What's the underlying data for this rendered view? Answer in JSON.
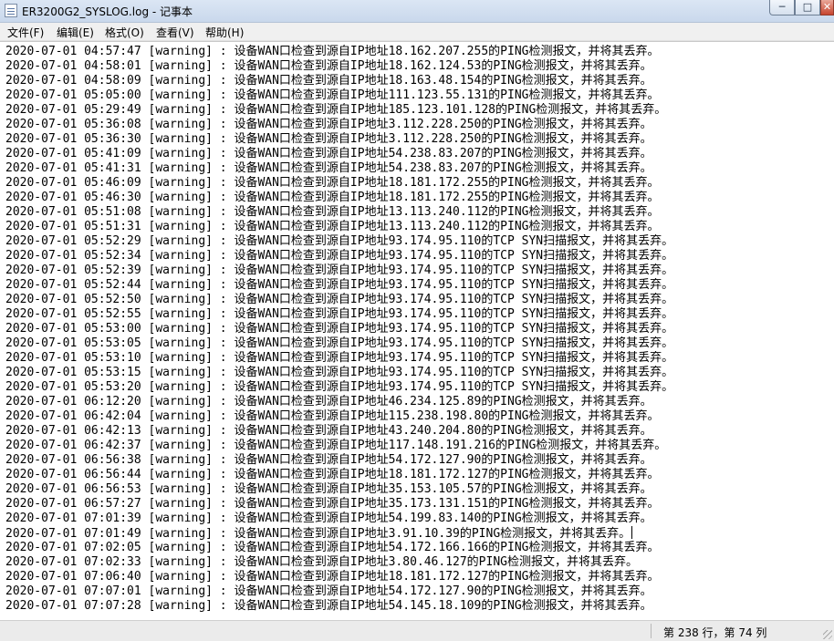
{
  "window": {
    "title": "ER3200G2_SYSLOG.log - 记事本",
    "controls": {
      "minimize": "─",
      "maximize": "□",
      "close": "✕"
    }
  },
  "menu": [
    "文件(F)",
    "编辑(E)",
    "格式(O)",
    "查看(V)",
    "帮助(H)"
  ],
  "lines": [
    "2020-07-01 04:57:47 [warning] : 设备WAN口检查到源自IP地址18.162.207.255的PING检测报文，并将其丢弃。",
    "2020-07-01 04:58:01 [warning] : 设备WAN口检查到源自IP地址18.162.124.53的PING检测报文，并将其丢弃。",
    "2020-07-01 04:58:09 [warning] : 设备WAN口检查到源自IP地址18.163.48.154的PING检测报文，并将其丢弃。",
    "2020-07-01 05:05:00 [warning] : 设备WAN口检查到源自IP地址111.123.55.131的PING检测报文，并将其丢弃。",
    "2020-07-01 05:29:49 [warning] : 设备WAN口检查到源自IP地址185.123.101.128的PING检测报文，并将其丢弃。",
    "2020-07-01 05:36:08 [warning] : 设备WAN口检查到源自IP地址3.112.228.250的PING检测报文，并将其丢弃。",
    "2020-07-01 05:36:30 [warning] : 设备WAN口检查到源自IP地址3.112.228.250的PING检测报文，并将其丢弃。",
    "2020-07-01 05:41:09 [warning] : 设备WAN口检查到源自IP地址54.238.83.207的PING检测报文，并将其丢弃。",
    "2020-07-01 05:41:31 [warning] : 设备WAN口检查到源自IP地址54.238.83.207的PING检测报文，并将其丢弃。",
    "2020-07-01 05:46:09 [warning] : 设备WAN口检查到源自IP地址18.181.172.255的PING检测报文，并将其丢弃。",
    "2020-07-01 05:46:30 [warning] : 设备WAN口检查到源自IP地址18.181.172.255的PING检测报文，并将其丢弃。",
    "2020-07-01 05:51:08 [warning] : 设备WAN口检查到源自IP地址13.113.240.112的PING检测报文，并将其丢弃。",
    "2020-07-01 05:51:31 [warning] : 设备WAN口检查到源自IP地址13.113.240.112的PING检测报文，并将其丢弃。",
    "2020-07-01 05:52:29 [warning] : 设备WAN口检查到源自IP地址93.174.95.110的TCP SYN扫描报文，并将其丢弃。",
    "2020-07-01 05:52:34 [warning] : 设备WAN口检查到源自IP地址93.174.95.110的TCP SYN扫描报文，并将其丢弃。",
    "2020-07-01 05:52:39 [warning] : 设备WAN口检查到源自IP地址93.174.95.110的TCP SYN扫描报文，并将其丢弃。",
    "2020-07-01 05:52:44 [warning] : 设备WAN口检查到源自IP地址93.174.95.110的TCP SYN扫描报文，并将其丢弃。",
    "2020-07-01 05:52:50 [warning] : 设备WAN口检查到源自IP地址93.174.95.110的TCP SYN扫描报文，并将其丢弃。",
    "2020-07-01 05:52:55 [warning] : 设备WAN口检查到源自IP地址93.174.95.110的TCP SYN扫描报文，并将其丢弃。",
    "2020-07-01 05:53:00 [warning] : 设备WAN口检查到源自IP地址93.174.95.110的TCP SYN扫描报文，并将其丢弃。",
    "2020-07-01 05:53:05 [warning] : 设备WAN口检查到源自IP地址93.174.95.110的TCP SYN扫描报文，并将其丢弃。",
    "2020-07-01 05:53:10 [warning] : 设备WAN口检查到源自IP地址93.174.95.110的TCP SYN扫描报文，并将其丢弃。",
    "2020-07-01 05:53:15 [warning] : 设备WAN口检查到源自IP地址93.174.95.110的TCP SYN扫描报文，并将其丢弃。",
    "2020-07-01 05:53:20 [warning] : 设备WAN口检查到源自IP地址93.174.95.110的TCP SYN扫描报文，并将其丢弃。",
    "2020-07-01 06:12:20 [warning] : 设备WAN口检查到源自IP地址46.234.125.89的PING检测报文，并将其丢弃。",
    "2020-07-01 06:42:04 [warning] : 设备WAN口检查到源自IP地址115.238.198.80的PING检测报文，并将其丢弃。",
    "2020-07-01 06:42:13 [warning] : 设备WAN口检查到源自IP地址43.240.204.80的PING检测报文，并将其丢弃。",
    "2020-07-01 06:42:37 [warning] : 设备WAN口检查到源自IP地址117.148.191.216的PING检测报文，并将其丢弃。",
    "2020-07-01 06:56:38 [warning] : 设备WAN口检查到源自IP地址54.172.127.90的PING检测报文，并将其丢弃。",
    "2020-07-01 06:56:44 [warning] : 设备WAN口检查到源自IP地址18.181.172.127的PING检测报文，并将其丢弃。",
    "2020-07-01 06:56:53 [warning] : 设备WAN口检查到源自IP地址35.153.105.57的PING检测报文，并将其丢弃。",
    "2020-07-01 06:57:27 [warning] : 设备WAN口检查到源自IP地址35.173.131.151的PING检测报文，并将其丢弃。",
    "2020-07-01 07:01:39 [warning] : 设备WAN口检查到源自IP地址54.199.83.140的PING检测报文，并将其丢弃。",
    "2020-07-01 07:01:49 [warning] : 设备WAN口检查到源自IP地址3.91.10.39的PING检测报文，并将其丢弃。",
    "2020-07-01 07:02:05 [warning] : 设备WAN口检查到源自IP地址54.172.166.166的PING检测报文，并将其丢弃。",
    "2020-07-01 07:02:33 [warning] : 设备WAN口检查到源自IP地址3.80.46.127的PING检测报文，并将其丢弃。",
    "2020-07-01 07:06:40 [warning] : 设备WAN口检查到源自IP地址18.181.172.127的PING检测报文，并将其丢弃。",
    "2020-07-01 07:07:01 [warning] : 设备WAN口检查到源自IP地址54.172.127.90的PING检测报文，并将其丢弃。",
    "2020-07-01 07:07:28 [warning] : 设备WAN口检查到源自IP地址54.145.18.109的PING检测报文，并将其丢弃。"
  ],
  "status": {
    "position": "第 238 行，第 74 列"
  }
}
